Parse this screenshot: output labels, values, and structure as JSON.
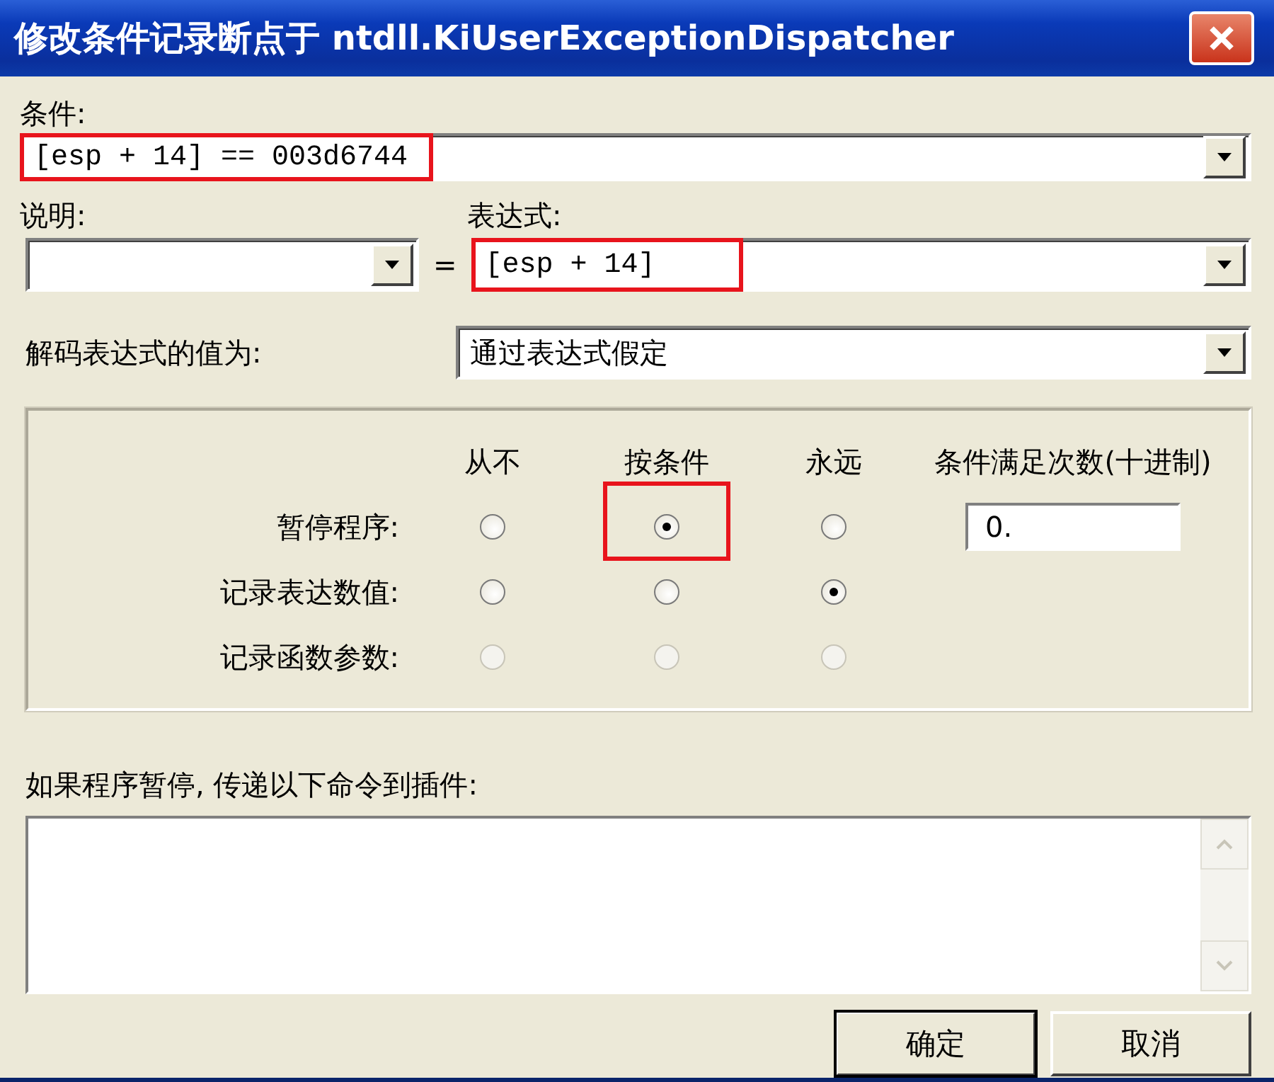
{
  "window": {
    "title": "修改条件记录断点于 ntdll.KiUserExceptionDispatcher"
  },
  "condition": {
    "label": "条件:",
    "value": "[esp + 14] == 003d6744",
    "highlighted": true
  },
  "description": {
    "label": "说明:"
  },
  "equals": "=",
  "expression": {
    "label": "表达式:",
    "value": "[esp + 14]",
    "highlighted": true
  },
  "decode": {
    "label": "解码表达式的值为:",
    "value": "通过表达式假定"
  },
  "actions": {
    "columns": [
      "从不",
      "按条件",
      "永远"
    ],
    "count_header": "条件满足次数(十进制)",
    "count_value": "0.",
    "rows": [
      {
        "label": "暂停程序:",
        "disabled": false,
        "options": [
          {
            "selected": false,
            "highlighted": false
          },
          {
            "selected": true,
            "highlighted": true
          },
          {
            "selected": false,
            "highlighted": false
          }
        ]
      },
      {
        "label": "记录表达数值:",
        "disabled": false,
        "options": [
          {
            "selected": false,
            "highlighted": false
          },
          {
            "selected": false,
            "highlighted": false
          },
          {
            "selected": true,
            "highlighted": false
          }
        ]
      },
      {
        "label": "记录函数参数:",
        "disabled": true,
        "options": [
          {
            "selected": false,
            "highlighted": false
          },
          {
            "selected": false,
            "highlighted": false
          },
          {
            "selected": false,
            "highlighted": false
          }
        ]
      }
    ]
  },
  "plugin": {
    "label": "如果程序暂停, 传递以下命令到插件:"
  },
  "buttons": [
    {
      "label": "确定",
      "default": true
    },
    {
      "label": "取消",
      "default": false
    }
  ]
}
